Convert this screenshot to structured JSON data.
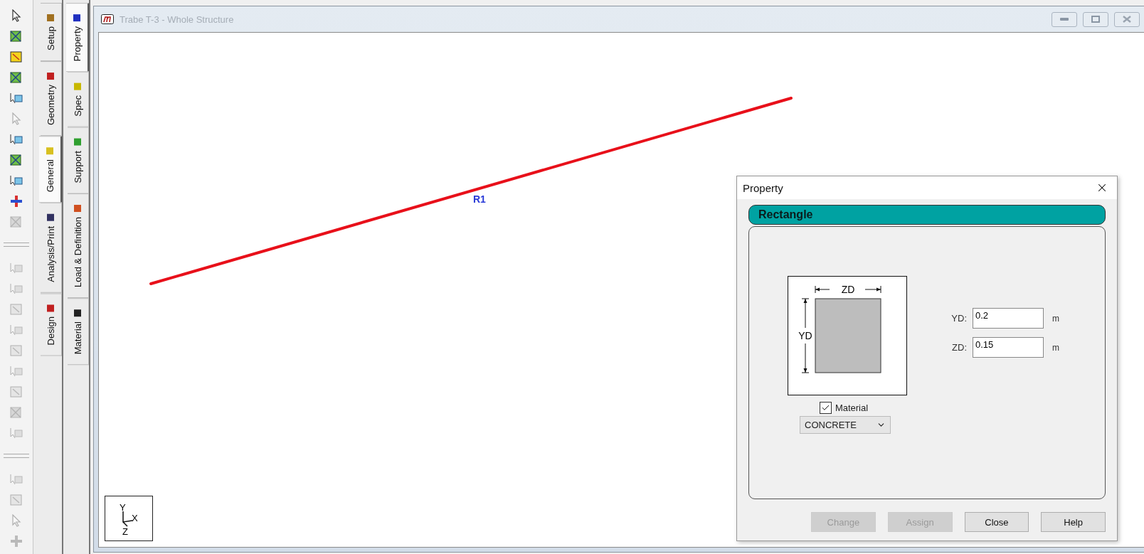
{
  "toolbar": [
    {
      "items": [
        {
          "kind": "pointer",
          "disabled": false
        },
        {
          "kind": "node",
          "disabled": false
        },
        {
          "kind": "plate",
          "disabled": false
        },
        {
          "kind": "node",
          "disabled": false
        },
        {
          "kind": "beam",
          "disabled": false
        },
        {
          "kind": "pointer",
          "disabled": true
        },
        {
          "kind": "beam",
          "disabled": false
        },
        {
          "kind": "node",
          "disabled": false
        },
        {
          "kind": "beam",
          "disabled": false
        },
        {
          "kind": "plus",
          "disabled": false
        },
        {
          "kind": "node",
          "disabled": true
        }
      ]
    },
    {
      "items": [
        {
          "kind": "beam",
          "disabled": true
        },
        {
          "kind": "beam",
          "disabled": true
        },
        {
          "kind": "plate",
          "disabled": true
        },
        {
          "kind": "beam",
          "disabled": true
        },
        {
          "kind": "plate",
          "disabled": true
        },
        {
          "kind": "beam",
          "disabled": true
        },
        {
          "kind": "plate",
          "disabled": true
        },
        {
          "kind": "node",
          "disabled": true
        },
        {
          "kind": "beam",
          "disabled": true
        }
      ]
    },
    {
      "items": [
        {
          "kind": "beam",
          "disabled": true
        },
        {
          "kind": "plate",
          "disabled": true
        },
        {
          "kind": "pointer",
          "disabled": true
        },
        {
          "kind": "plus",
          "disabled": true
        }
      ]
    }
  ],
  "tab_strips": [
    {
      "tabs": [
        {
          "label": "Setup",
          "selected": false
        },
        {
          "label": "Geometry",
          "selected": false
        },
        {
          "label": "General",
          "selected": true
        },
        {
          "label": "Analysis/Print",
          "selected": false
        },
        {
          "label": "Design",
          "selected": false
        }
      ]
    },
    {
      "tabs": [
        {
          "label": "Property",
          "selected": true
        },
        {
          "label": "Spec",
          "selected": false
        },
        {
          "label": "Support",
          "selected": false
        },
        {
          "label": "Load & Definition",
          "selected": false
        },
        {
          "label": "Material",
          "selected": false
        }
      ]
    }
  ],
  "window": {
    "title": "Trabe T-3 - Whole Structure"
  },
  "canvas": {
    "member_label": "R1",
    "axes": {
      "y": "Y",
      "x": "X",
      "z": "Z"
    }
  },
  "dialog": {
    "title": "Property",
    "section": "Rectangle",
    "diagram": {
      "width_label": "ZD",
      "height_label": "YD"
    },
    "fields": [
      {
        "label": "YD:",
        "value": "0.2",
        "unit": "m"
      },
      {
        "label": "ZD:",
        "value": "0.15",
        "unit": "m"
      }
    ],
    "material": {
      "label": "Material",
      "checked": true,
      "value": "CONCRETE"
    },
    "buttons": [
      {
        "label": "Change",
        "disabled": true
      },
      {
        "label": "Assign",
        "disabled": true
      },
      {
        "label": "Close",
        "disabled": false
      },
      {
        "label": "Help",
        "disabled": false
      }
    ]
  }
}
